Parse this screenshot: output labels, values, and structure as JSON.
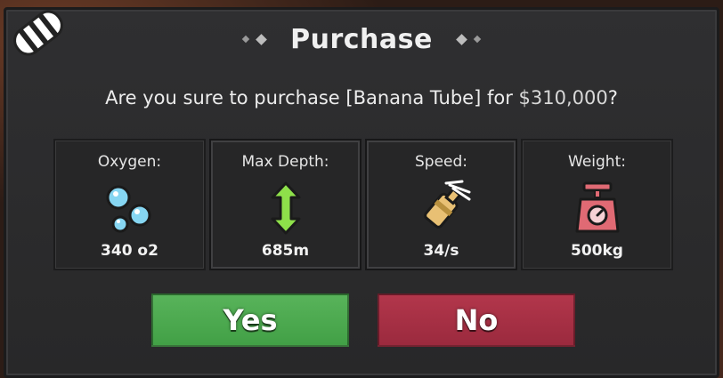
{
  "dialog": {
    "title": "Purchase",
    "question_prefix": "Are you sure to purchase ",
    "item_name": "[Banana Tube]",
    "question_mid": " for ",
    "price": "$310,000",
    "question_suffix": "?"
  },
  "stats": [
    {
      "label": "Oxygen:",
      "value": "340 o2",
      "icon": "bubbles-icon"
    },
    {
      "label": "Max Depth:",
      "value": "685m",
      "icon": "vertical-arrows-icon"
    },
    {
      "label": "Speed:",
      "value": "34/s",
      "icon": "propeller-icon"
    },
    {
      "label": "Weight:",
      "value": "500kg",
      "icon": "scale-icon"
    }
  ],
  "buttons": {
    "yes_label": "Yes",
    "no_label": "No"
  },
  "colors": {
    "yes": "#4caa50",
    "no": "#a83046",
    "panel": "#2d2d2f",
    "oxygen": "#7fd4f0",
    "depth": "#8ee04a",
    "speed": "#e8c074",
    "weight": "#e06a74"
  },
  "corner_icon": "tube-icon"
}
